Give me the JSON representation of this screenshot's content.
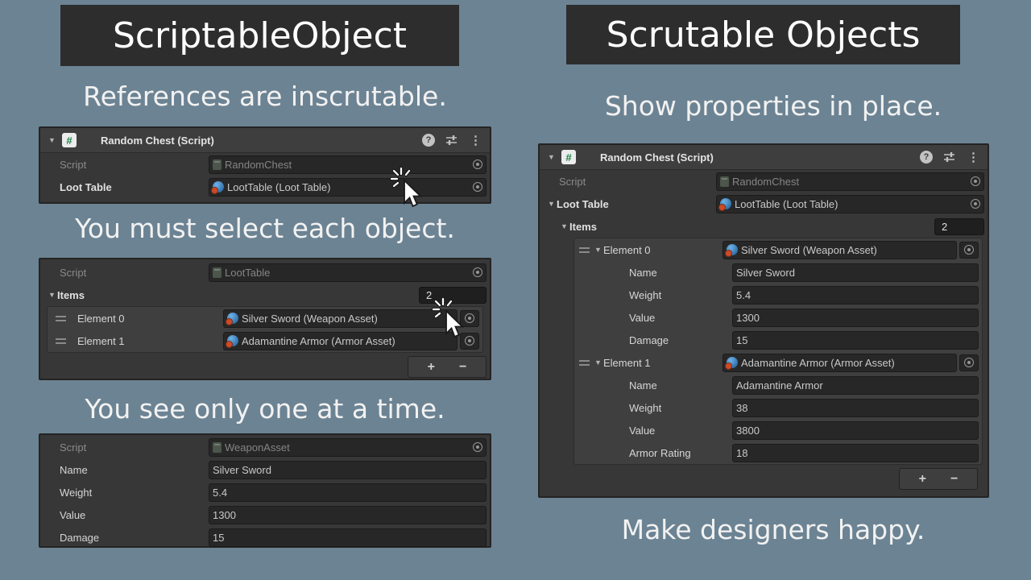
{
  "colors": {
    "background": "#6c8393",
    "title_bg": "#2d2d2d",
    "panel_bg": "#373737",
    "header_bg": "#3e3e3e",
    "field_bg": "#272727",
    "accent_blue": "#3d85c6",
    "accent_orange": "#cc4b26",
    "text_light": "#f2f2f2"
  },
  "icons": {
    "foldout": "▼",
    "help": "?",
    "kebab": "⋮",
    "script_hash": "#"
  },
  "left": {
    "title": "ScriptableObject",
    "caption_top": "References are inscrutable.",
    "chest": {
      "header": "Random Chest (Script)",
      "script_label": "Script",
      "script_value": "RandomChest",
      "loot_label": "Loot Table",
      "loot_value": "LootTable (Loot Table)"
    },
    "caption_mid": "You must select each object.",
    "table": {
      "script_label": "Script",
      "script_value": "LootTable",
      "items_label": "Items",
      "items_count": "2",
      "elements": [
        {
          "label": "Element 0",
          "value": "Silver Sword (Weapon Asset)"
        },
        {
          "label": "Element 1",
          "value": "Adamantine Armor (Armor Asset)"
        }
      ],
      "add": "+",
      "remove": "−"
    },
    "caption_bottom": "You see only one at a time.",
    "weapon": {
      "script_label": "Script",
      "script_value": "WeaponAsset",
      "fields": [
        {
          "label": "Name",
          "value": "Silver Sword"
        },
        {
          "label": "Weight",
          "value": "5.4"
        },
        {
          "label": "Value",
          "value": "1300"
        },
        {
          "label": "Damage",
          "value": "15"
        }
      ]
    }
  },
  "right": {
    "title": "Scrutable Objects",
    "caption_top": "Show properties in place.",
    "panel": {
      "header": "Random Chest (Script)",
      "script_label": "Script",
      "script_value": "RandomChest",
      "loot_label": "Loot Table",
      "loot_value": "LootTable (Loot Table)",
      "items_label": "Items",
      "items_count": "2",
      "elements": [
        {
          "label": "Element 0",
          "value": "Silver Sword (Weapon Asset)",
          "fields": [
            {
              "label": "Name",
              "value": "Silver Sword"
            },
            {
              "label": "Weight",
              "value": "5.4"
            },
            {
              "label": "Value",
              "value": "1300"
            },
            {
              "label": "Damage",
              "value": "15"
            }
          ]
        },
        {
          "label": "Element 1",
          "value": "Adamantine Armor (Armor Asset)",
          "fields": [
            {
              "label": "Name",
              "value": "Adamantine Armor"
            },
            {
              "label": "Weight",
              "value": "38"
            },
            {
              "label": "Value",
              "value": "3800"
            },
            {
              "label": "Armor Rating",
              "value": "18"
            }
          ]
        }
      ],
      "add": "+",
      "remove": "−"
    },
    "caption_bottom": "Make designers happy."
  }
}
